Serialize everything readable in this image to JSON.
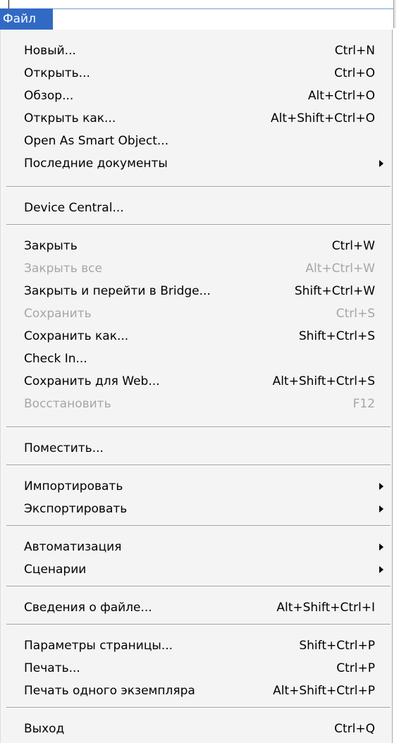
{
  "menubar": {
    "title": "Файл"
  },
  "menu": {
    "items": [
      {
        "label": "Новый...",
        "shortcut": "Ctrl+N"
      },
      {
        "label": "Открыть...",
        "shortcut": "Ctrl+O"
      },
      {
        "label": "Обзор...",
        "shortcut": "Alt+Ctrl+O"
      },
      {
        "label": "Открыть как...",
        "shortcut": "Alt+Shift+Ctrl+O"
      },
      {
        "label": "Open As Smart Object...",
        "shortcut": ""
      },
      {
        "label": "Последние документы",
        "shortcut": "",
        "submenu": true
      },
      {
        "label": "Device Central...",
        "shortcut": ""
      },
      {
        "label": "Закрыть",
        "shortcut": "Ctrl+W"
      },
      {
        "label": "Закрыть все",
        "shortcut": "Alt+Ctrl+W",
        "disabled": true
      },
      {
        "label": "Закрыть и перейти в Bridge...",
        "shortcut": "Shift+Ctrl+W"
      },
      {
        "label": "Сохранить",
        "shortcut": "Ctrl+S",
        "disabled": true
      },
      {
        "label": "Сохранить как...",
        "shortcut": "Shift+Ctrl+S"
      },
      {
        "label": "Check In...",
        "shortcut": ""
      },
      {
        "label": "Сохранить для Web...",
        "shortcut": "Alt+Shift+Ctrl+S"
      },
      {
        "label": "Восстановить",
        "shortcut": "F12",
        "disabled": true
      },
      {
        "label": "Поместить...",
        "shortcut": ""
      },
      {
        "label": "Импортировать",
        "shortcut": "",
        "submenu": true
      },
      {
        "label": "Экспортировать",
        "shortcut": "",
        "submenu": true
      },
      {
        "label": "Автоматизация",
        "shortcut": "",
        "submenu": true
      },
      {
        "label": "Сценарии",
        "shortcut": "",
        "submenu": true
      },
      {
        "label": "Сведения о файле...",
        "shortcut": "Alt+Shift+Ctrl+I"
      },
      {
        "label": "Параметры страницы...",
        "shortcut": "Shift+Ctrl+P"
      },
      {
        "label": "Печать...",
        "shortcut": "Ctrl+P"
      },
      {
        "label": "Печать одного экземпляра",
        "shortcut": "Alt+Shift+Ctrl+P"
      },
      {
        "label": "Выход",
        "shortcut": "Ctrl+Q"
      }
    ]
  },
  "colors": {
    "menu_title_bg": "#316ac5",
    "menu_bg": "#f4f4f4",
    "disabled_text": "#a6a6a6"
  }
}
